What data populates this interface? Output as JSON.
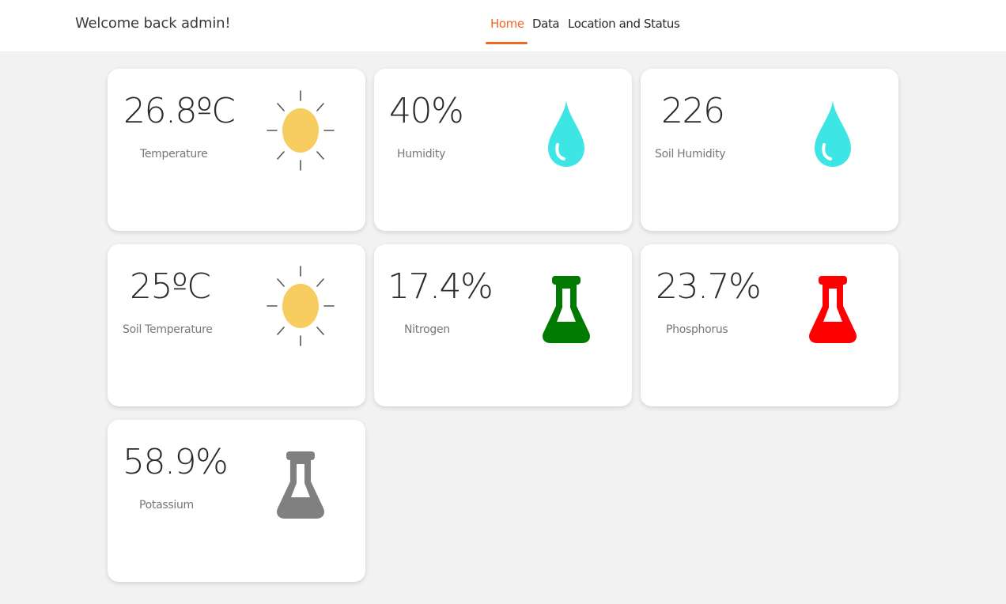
{
  "header": {
    "welcome": "Welcome back admin!",
    "nav": [
      {
        "label": "Home",
        "active": true
      },
      {
        "label": "Data",
        "active": false
      },
      {
        "label": "Location and Status",
        "active": false
      }
    ],
    "accent": "#f26622"
  },
  "cards": [
    {
      "value": "26.8ºC",
      "label": "Temperature",
      "icon": "sun-icon",
      "color": "#f7cd60"
    },
    {
      "value": "40%",
      "label": "Humidity",
      "icon": "water-drop-icon",
      "color": "#3ee5e5"
    },
    {
      "value": "226",
      "label": "Soil Humidity",
      "icon": "water-drop-icon",
      "color": "#3ee5e5"
    },
    {
      "value": "25ºC",
      "label": "Soil Temperature",
      "icon": "sun-icon",
      "color": "#f7cd60"
    },
    {
      "value": "17.4%",
      "label": "Nitrogen",
      "icon": "flask-icon",
      "color": "#007a00"
    },
    {
      "value": "23.7%",
      "label": "Phosphorus",
      "icon": "flask-icon",
      "color": "#ff0000"
    },
    {
      "value": "58.9%",
      "label": "Potassium",
      "icon": "flask-icon",
      "color": "#808080"
    }
  ]
}
